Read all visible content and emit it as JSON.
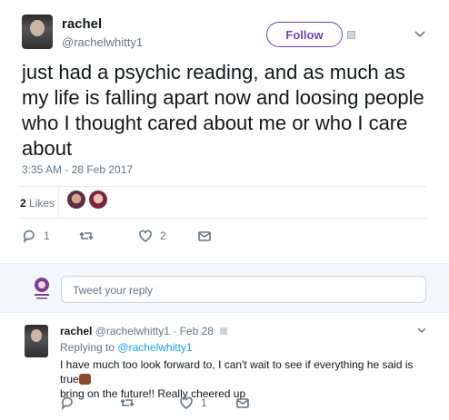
{
  "tweet": {
    "name": "rachel",
    "handle": "@rachelwhitty1",
    "follow_label": "Follow",
    "text": "just had a psychic reading, and as much as my life is falling apart now and loosing people who I thought cared about me or who I care about",
    "timestamp": "3:35 AM - 28 Feb 2017",
    "likes_number": "2",
    "likes_label": "Likes",
    "actions": {
      "reply_count": "1",
      "retweet_count": "",
      "like_count": "2"
    },
    "icons": [
      "reply-icon",
      "retweet-icon",
      "heart-icon",
      "message-icon",
      "chevron-down-icon"
    ]
  },
  "reply_box": {
    "placeholder": "Tweet your reply"
  },
  "reply": {
    "name": "rachel",
    "handle_date": "@rachelwhitty1 · Feb 28",
    "replying_prefix": "Replying to",
    "replying_to": "@rachelwhitty1",
    "text": "I have much too look forward to, I can't wait to see if everything he said is true",
    "text2": "bring on the future!! Really cheered up",
    "actions": {
      "reply_count": "",
      "retweet_count": "",
      "like_count": "1"
    }
  },
  "colors": {
    "accent": "#6f42c1",
    "link": "#1da1f2",
    "muted": "#657786"
  }
}
